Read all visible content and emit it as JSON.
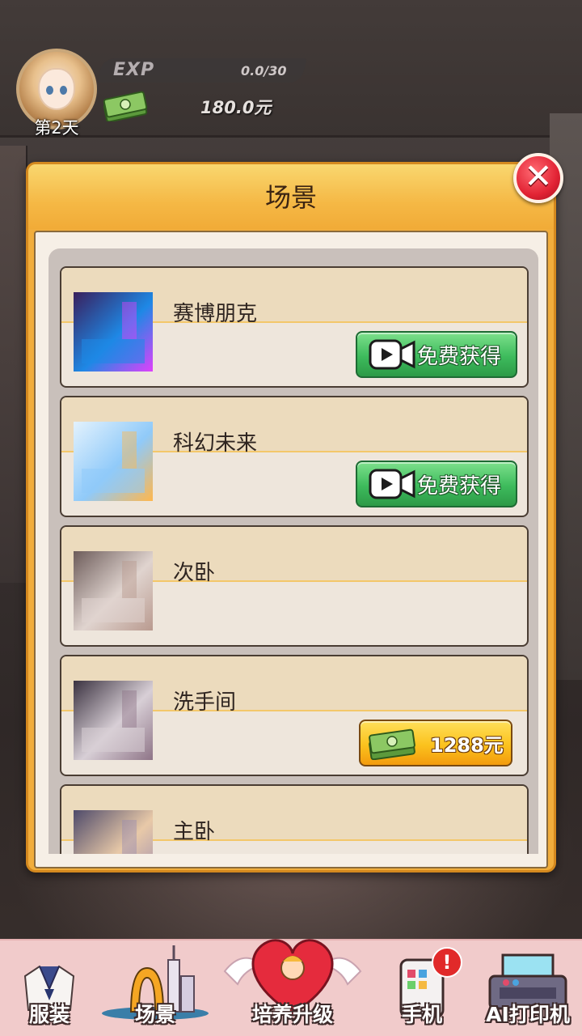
{
  "hud": {
    "day": "第2天",
    "exp_label": "EXP",
    "exp_value": "0.0/30",
    "money": "180.0元"
  },
  "modal": {
    "title": "场景",
    "close_icon": "close-icon",
    "scenes": [
      {
        "name": "赛博朋克",
        "action": "free",
        "button_label": "免费获得",
        "thumb_colors": [
          "#3a1f5c",
          "#1e88e5",
          "#e040fb"
        ]
      },
      {
        "name": "科幻未来",
        "action": "free",
        "button_label": "免费获得",
        "thumb_colors": [
          "#e3f2fd",
          "#90caf9",
          "#ffb74d"
        ]
      },
      {
        "name": "次卧",
        "action": "owned",
        "button_label": "",
        "thumb_colors": [
          "#6d5c5a",
          "#e0d4cf",
          "#b99a8f"
        ]
      },
      {
        "name": "洗手间",
        "action": "buy",
        "button_label": "1288元",
        "thumb_colors": [
          "#3b3240",
          "#d8cfd6",
          "#8e7487"
        ]
      },
      {
        "name": "主卧",
        "action": "partial",
        "button_label": "",
        "thumb_colors": [
          "#4e4a6a",
          "#e8c9a8",
          "#9a8bb0"
        ]
      }
    ]
  },
  "nav": {
    "items": [
      {
        "label": "服装",
        "icon": "uniform-icon"
      },
      {
        "label": "场景",
        "icon": "city-scene-icon"
      },
      {
        "label": "培养升级",
        "icon": "heart-cupid-icon"
      },
      {
        "label": "手机",
        "icon": "phone-icon"
      },
      {
        "label": "AI打印机",
        "icon": "printer-icon"
      }
    ],
    "phone_badge": "!"
  },
  "colors": {
    "modal_orange": "#f1ad3c",
    "free_button_green": "#3dbb5c",
    "price_button_gold": "#fbc21e",
    "close_red": "#e22334"
  }
}
